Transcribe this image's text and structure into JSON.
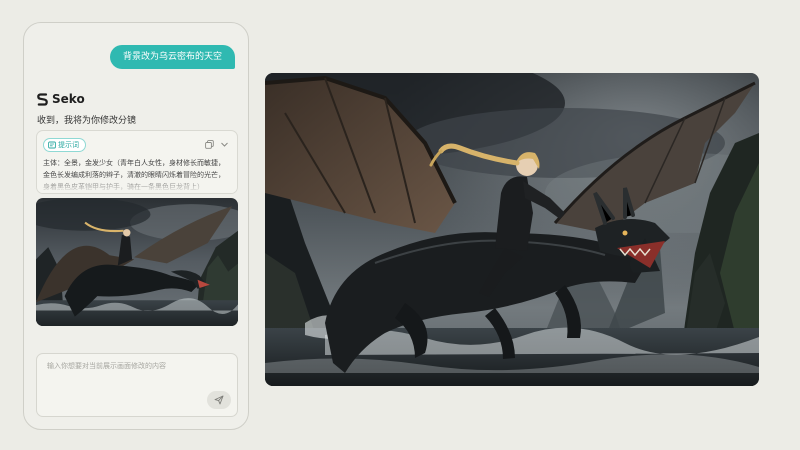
{
  "chat": {
    "user_message": "背景改为乌云密布的天空",
    "brand_name": "Seko",
    "assistant_message": "收到，我将为你修改分镜"
  },
  "prompt_card": {
    "badge_label": "提示词",
    "text": "主体：全景，金发少女（青年白人女性，身材修长而敏捷，金色长发编成利落的辫子，清澈的眼睛闪烁着冒险的光芒，身着黑色皮革铠甲与护手，骑在一条黑色巨龙背上）"
  },
  "input": {
    "placeholder": "输入你想要对当前展示画面修改的内容",
    "value": ""
  },
  "icons": {
    "brand": "seko-logo",
    "badge": "tag-icon",
    "copy": "copy-icon",
    "expand": "chevron-down-icon",
    "send": "send-icon"
  },
  "colors": {
    "accent": "#2fb9b1",
    "background": "#ecece6"
  }
}
